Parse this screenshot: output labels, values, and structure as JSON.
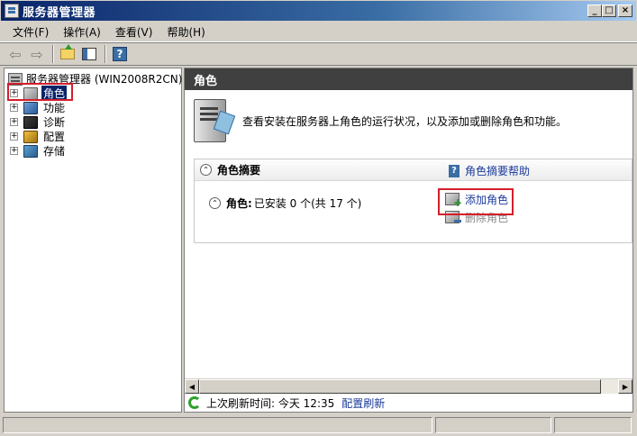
{
  "window": {
    "title": "服务器管理器"
  },
  "window_buttons": [
    "_",
    "□",
    "×"
  ],
  "menu": [
    "文件(F)",
    "操作(A)",
    "查看(V)",
    "帮助(H)"
  ],
  "toolbar": {
    "back_glyph": "⇦",
    "forward_glyph": "⇨",
    "help_glyph": "?"
  },
  "tree": {
    "root": "服务器管理器 (WIN2008R2CN)",
    "expander_glyph": "+",
    "items": [
      {
        "label": "角色",
        "icon": "roles-icon",
        "selected": true
      },
      {
        "label": "功能",
        "icon": "features-icon"
      },
      {
        "label": "诊断",
        "icon": "diagnostics-icon"
      },
      {
        "label": "配置",
        "icon": "configuration-icon"
      },
      {
        "label": "存储",
        "icon": "storage-icon"
      }
    ]
  },
  "main": {
    "header": "角色",
    "intro": "查看安装在服务器上角色的运行状况，以及添加或删除角色和功能。",
    "summary": {
      "title": "角色摘要",
      "collapse_glyph": "⌃",
      "help_link": "角色摘要帮助",
      "roles_label": "角色:",
      "roles_status": "已安装 0 个(共 17 个)",
      "actions": [
        "添加角色",
        "删除角色"
      ]
    },
    "refresh": {
      "text": "上次刷新时间: 今天 12:35",
      "link": "配置刷新"
    }
  },
  "colors": {
    "accent_highlight": "#d41f2c",
    "link": "#1a3a9a",
    "header_bg": "#404040"
  }
}
